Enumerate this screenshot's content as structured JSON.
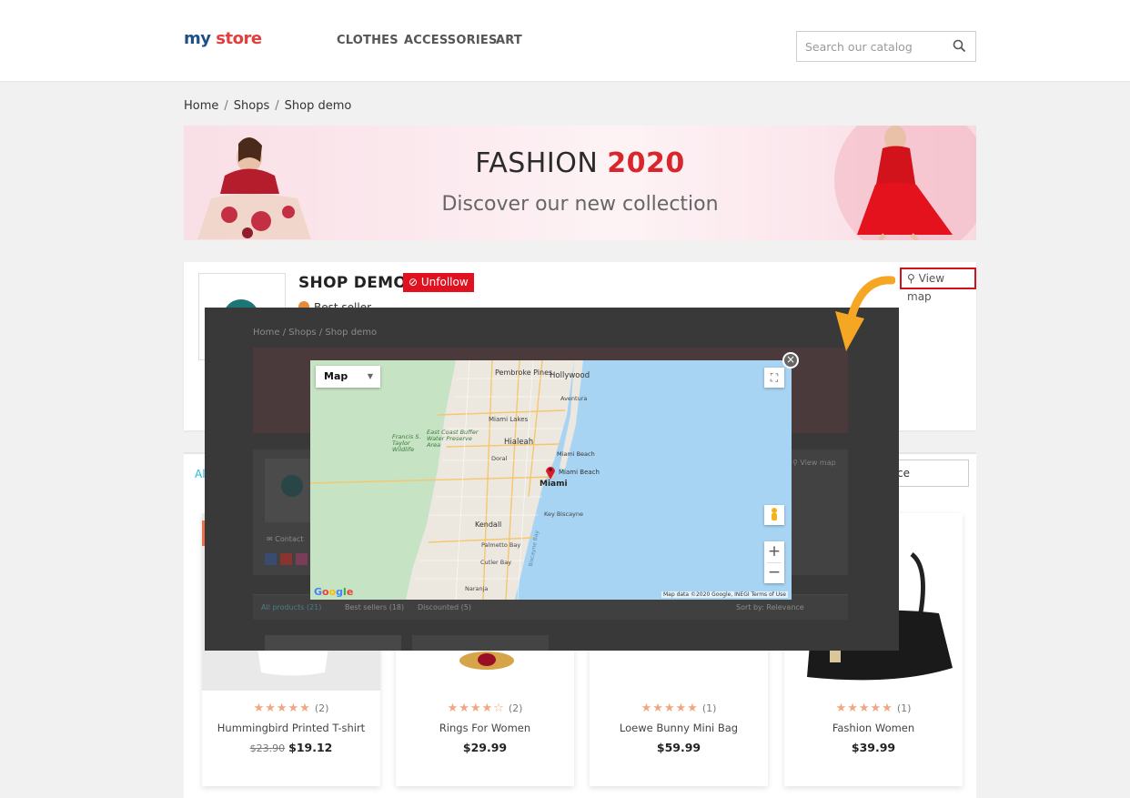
{
  "header": {
    "logo_my": "my",
    "logo_store": "store",
    "nav": [
      "CLOTHES",
      "ACCESSORIES",
      "ART"
    ],
    "search_placeholder": "Search our catalog"
  },
  "breadcrumb": [
    "Home",
    "Shops",
    "Shop demo"
  ],
  "banner": {
    "title_word": "FASHION",
    "title_year": "2020",
    "subtitle": "Discover our new collection"
  },
  "shop": {
    "name": "SHOP DEMO",
    "unfollow_label": "Unfollow",
    "badge": "Best seller",
    "view_map_label": "View map"
  },
  "products_section": {
    "tab_all_label": "Al",
    "right_input_value": "ce"
  },
  "products": [
    {
      "name": "Hummingbird Printed T-shirt",
      "rating": 5,
      "stars": "★★★★★",
      "reviews": "(2)",
      "old_price": "$23.90",
      "price": "$19.12"
    },
    {
      "name": "Rings For Women",
      "rating": 4.5,
      "stars": "★★★★☆",
      "reviews": "(2)",
      "old_price": "",
      "price": "$29.99"
    },
    {
      "name": "Loewe Bunny Mini Bag",
      "rating": 5,
      "stars": "★★★★★",
      "reviews": "(1)",
      "old_price": "",
      "price": "$59.99"
    },
    {
      "name": "Fashion Women",
      "rating": 5,
      "stars": "★★★★★",
      "reviews": "(1)",
      "old_price": "",
      "price": "$39.99"
    }
  ],
  "modal": {
    "background_breadcrumb": [
      "Home",
      "Shops",
      "Shop demo"
    ],
    "background_tabs": {
      "all_products": "All products (21)",
      "best_sellers": "Best sellers (18)",
      "discounted": "Discounted (5)",
      "sort": "Sort by: Relevance",
      "contact": "Contact",
      "view_map": "View map"
    },
    "map": {
      "type_label": "Map",
      "google_label": "Google",
      "attribution": "Map data ©2020 Google, INEGI   Terms of Use",
      "zoom_in": "+",
      "zoom_out": "−",
      "close": "×",
      "place_labels": {
        "pembroke_pines": "Pembroke Pines",
        "hollywood": "Hollywood",
        "aventura": "Aventura",
        "miami_lakes": "Miami Lakes",
        "east_coast": "East Coast Buffer Water Preserve Area",
        "francis_taylor": "Francis S. Taylor Wildlife",
        "hialeah": "Hialeah",
        "miami_beach_n": "Miami Beach",
        "doral": "Doral",
        "miami_beach": "Miami Beach",
        "miami": "Miami",
        "key_biscayne": "Key Biscayne",
        "kendall": "Kendall",
        "palmetto_bay": "Palmetto Bay",
        "cutler_bay": "Cutler Bay",
        "biscayne_bay": "Biscayne Bay",
        "naranja": "Naranja"
      }
    }
  },
  "colors": {
    "accent_red": "#e0121f",
    "link_blue": "#24b9d7",
    "star_orange": "#f0a77f",
    "map_water": "#a8d4f3",
    "map_land": "#c6e3c3",
    "urban": "#ece8e0"
  }
}
